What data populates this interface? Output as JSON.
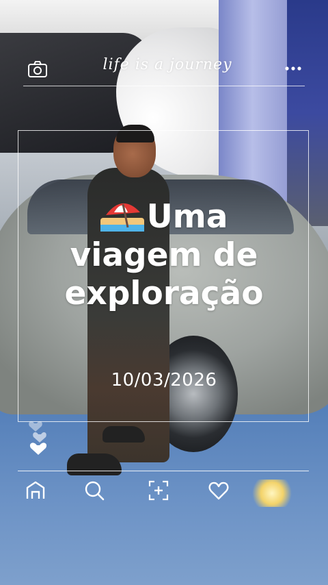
{
  "header": {
    "camera_icon": "camera-icon",
    "script_text": "life is a journey",
    "more_icon": "more-dots-icon"
  },
  "card": {
    "emoji": "beach-umbrella",
    "title_line1": "Uma",
    "title_line2": "viagem de",
    "title_line3": "exploração",
    "date": "10/03/2026"
  },
  "bottom_nav": {
    "items": [
      {
        "icon": "home-icon"
      },
      {
        "icon": "search-icon"
      },
      {
        "icon": "add-icon"
      },
      {
        "icon": "heart-icon"
      }
    ]
  },
  "colors": {
    "overlay_text": "#ffffff",
    "umbrella_red": "#e53935",
    "sand": "#f3c77a",
    "water": "#4fb3e8"
  }
}
